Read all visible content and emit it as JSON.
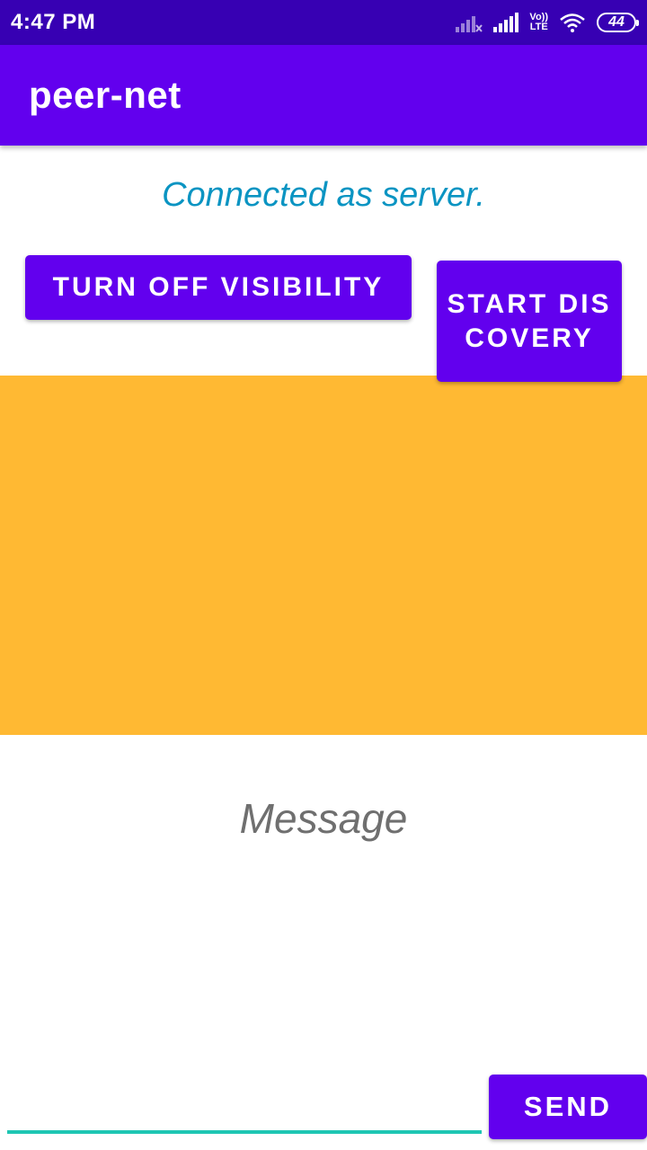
{
  "status_bar": {
    "time": "4:47 PM",
    "network_label_top": "Vo))",
    "network_label_bottom": "LTE",
    "battery": "44",
    "icons": [
      "signal-muted-icon",
      "signal-icon",
      "volte-lte-icon",
      "wifi-icon",
      "battery-icon"
    ]
  },
  "app_bar": {
    "title": "peer-net"
  },
  "main": {
    "status_text": "Connected as server.",
    "visibility_button": "TURN OFF VISIBILITY",
    "discovery_button": "START DISCOVERY",
    "message_text": "Message",
    "message_input_value": "",
    "send_button": "SEND"
  },
  "colors": {
    "status_bar": "#3700b3",
    "primary": "#6200ee",
    "status_text": "#0a94c2",
    "peer_area": "#ffb933",
    "input_underline": "#1fc6b3"
  }
}
